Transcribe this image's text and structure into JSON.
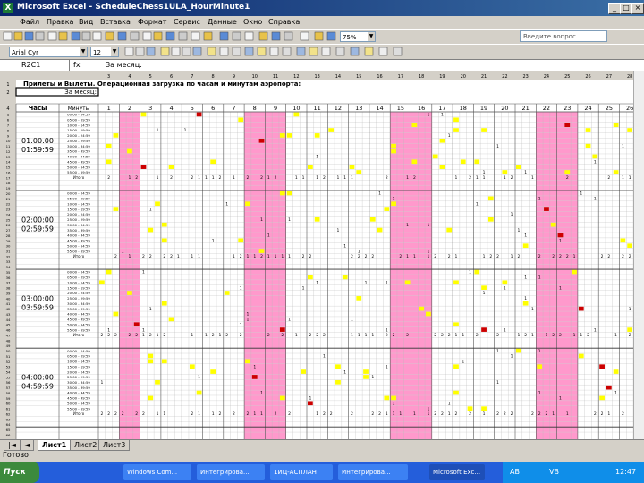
{
  "window": {
    "title": "Microsoft Excel - ScheduleChess1ULA_HourMinute1",
    "controls": [
      "_",
      "□",
      "×"
    ]
  },
  "menu": [
    "Файл",
    "Правка",
    "Вид",
    "Вставка",
    "Формат",
    "Сервис",
    "Данные",
    "Окно",
    "Справка"
  ],
  "ask_placeholder": "Введите вопрос",
  "toolbar": {
    "zoom": "75%",
    "font_name": "Arial Cyr",
    "font_size": "12"
  },
  "formula_bar": {
    "name_box": "R2C1",
    "fx": "fx",
    "content": "За месяц:"
  },
  "sheet": {
    "title_row": "Прилеты и Вылеты. Операционная загрузка по часам и минутам аэропорта:",
    "row2_label": "За месяц:",
    "hdr_hours": "Часы",
    "hdr_minutes": "Минуты",
    "days": [
      "1",
      "2",
      "3",
      "4",
      "5",
      "6",
      "7",
      "8",
      "9",
      "10",
      "11",
      "12",
      "13",
      "14",
      "15",
      "16",
      "17",
      "18",
      "19",
      "20",
      "21",
      "22",
      "23",
      "24",
      "25",
      "26"
    ],
    "hours": [
      {
        "start": "01:00:00",
        "end": "01:59:59"
      },
      {
        "start": "02:00:00",
        "end": "02:59:59"
      },
      {
        "start": "03:00:00",
        "end": "03:59:59"
      },
      {
        "start": "04:00:00",
        "end": "04:59:59"
      }
    ],
    "minute_ranges": [
      "00:00 - 04:59",
      "05:00 - 09:59",
      "10:00 - 14:59",
      "15:00 - 19:59",
      "20:00 - 24:59",
      "25:00 - 29:59",
      "30:00 - 34:59",
      "35:00 - 39:59",
      "40:00 - 44:59",
      "45:00 - 49:59",
      "50:00 - 54:59",
      "55:00 - 59:59"
    ],
    "total_label": "Итого",
    "colors": {
      "weekend": "#ff99cc",
      "yellow": "#ffff00",
      "red": "#cc0000",
      "grid": "#c0c0c0"
    }
  },
  "sheet_tabs": [
    "Лист1",
    "Лист2",
    "Лист3"
  ],
  "status": "Готово",
  "taskbar": {
    "start": "Пуск",
    "tasks": [
      "Windows Com...",
      "Интегрирова...",
      "1ИЦ-АСПЛАН",
      "Интегрирова...",
      "Microsoft Exc..."
    ],
    "tray": {
      "lang1": "AB",
      "lang2": "VB",
      "clock": "12:47"
    }
  }
}
